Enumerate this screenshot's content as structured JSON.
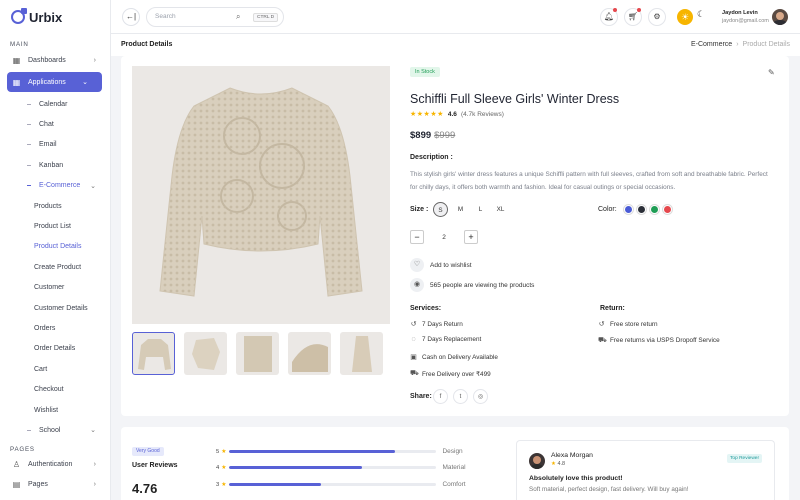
{
  "brand": {
    "name": "Urbix"
  },
  "sidebar": {
    "sections": [
      "MAIN",
      "PAGES"
    ],
    "top_items": [
      {
        "label": "Dashboards",
        "icon": "grid-icon"
      },
      {
        "label": "Applications",
        "icon": "apps-icon"
      },
      {
        "label": "Authentication",
        "icon": "user-icon"
      },
      {
        "label": "Pages",
        "icon": "document-icon"
      }
    ],
    "app_items": [
      "Calendar",
      "Chat",
      "Email",
      "Kanban",
      "E-Commerce",
      "School"
    ],
    "ecommerce_items": [
      "Products",
      "Product List",
      "Product Details",
      "Create Product",
      "Customer",
      "Customer Details",
      "Orders",
      "Order Details",
      "Cart",
      "Checkout",
      "Wishlist"
    ]
  },
  "topbar": {
    "search_placeholder": "Search",
    "search_shortcut": "CTRL D",
    "user_name": "Jaydon Levin",
    "user_email": "jaydon@gmail.com"
  },
  "page": {
    "title": "Product Details",
    "breadcrumb": [
      "E-Commerce",
      "Product Details"
    ]
  },
  "product": {
    "stock_status": "In Stock",
    "name": "Schiffli Full Sleeve Girls' Winter Dress",
    "rating": "4.6",
    "rating_stars": 4.5,
    "reviews": "(4.7k Reviews)",
    "price": "$899",
    "old_price": "$999",
    "description_label": "Description :",
    "description": "This stylish girls' winter dress features a unique Schiffli pattern with full sleeves, crafted from soft and breathable fabric. Perfect for chilly days, it offers both warmth and fashion. Ideal for casual outings or special occasions.",
    "size_label": "Size :",
    "sizes": [
      "S",
      "M",
      "L",
      "XL"
    ],
    "selected_size": "S",
    "color_label": "Color:",
    "colors": [
      "#4a5bd6",
      "#2b2f38",
      "#1f9d55",
      "#e5484d"
    ],
    "quantity": "2",
    "wishlist_label": "Add to wishlist",
    "viewers_label": "565 people are viewing the products",
    "services_label": "Services:",
    "services": [
      "7 Days Return",
      "7 Days Replacement",
      "Cash on Delivery Available",
      "Free Delivery over ₹499"
    ],
    "return_label": "Return:",
    "returns": [
      "Free store return",
      "Free returns via USPS Dropoff Service"
    ],
    "share_label": "Share:",
    "share_icons": [
      "facebook-icon",
      "twitter-icon",
      "dribbble-icon"
    ]
  },
  "reviews_summary": {
    "badge": "Very Good",
    "title": "User Reviews",
    "score": "4.76",
    "bars": [
      {
        "star": "5",
        "fraction": 0.8,
        "label": "Design"
      },
      {
        "star": "4",
        "fraction": 0.64,
        "label": "Material"
      },
      {
        "star": "3",
        "fraction": 0.44,
        "label": "Comfort"
      }
    ]
  },
  "review": {
    "name": "Alexa Morgan",
    "rating": "4.8",
    "badge": "Top Reviewer",
    "title": "Absolutely love this product!",
    "text": "Soft material, perfect design, fast delivery. Will buy again!"
  }
}
